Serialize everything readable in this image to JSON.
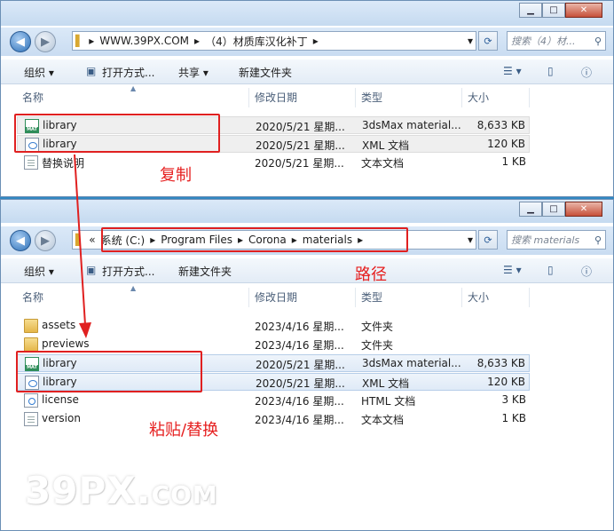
{
  "window1": {
    "controls": {
      "minimize": "▁",
      "maximize": "□",
      "close": "✕"
    },
    "breadcrumb": [
      "WWW.39PX.COM",
      "（4）材质库汉化补丁"
    ],
    "search_placeholder": "搜索（4）材...",
    "toolbar": {
      "organize": "组织",
      "open_with": "打开方式...",
      "share": "共享",
      "new_folder": "新建文件夹"
    },
    "columns": {
      "name": "名称",
      "date": "修改日期",
      "type": "类型",
      "size": "大小"
    },
    "files": [
      {
        "name": "library",
        "date": "2020/5/21 星期...",
        "type": "3dsMax material...",
        "size": "8,633 KB",
        "icon": "mat-file-icon"
      },
      {
        "name": "library",
        "date": "2020/5/21 星期...",
        "type": "XML 文档",
        "size": "120 KB",
        "icon": "xml-file-icon"
      },
      {
        "name": "替换说明",
        "date": "2020/5/21 星期...",
        "type": "文本文档",
        "size": "1 KB",
        "icon": "text-file-icon"
      }
    ]
  },
  "window2": {
    "controls": {
      "minimize": "▁",
      "maximize": "□",
      "close": "✕"
    },
    "breadcrumb": [
      "系统 (C:)",
      "Program Files",
      "Corona",
      "materials"
    ],
    "search_placeholder": "搜索 materials",
    "toolbar": {
      "organize": "组织",
      "open_with": "打开方式...",
      "new_folder": "新建文件夹"
    },
    "columns": {
      "name": "名称",
      "date": "修改日期",
      "type": "类型",
      "size": "大小"
    },
    "files": [
      {
        "name": "assets",
        "date": "2023/4/16 星期...",
        "type": "文件夹",
        "size": "",
        "icon": "folder-icon"
      },
      {
        "name": "previews",
        "date": "2023/4/16 星期...",
        "type": "文件夹",
        "size": "",
        "icon": "folder-icon"
      },
      {
        "name": "library",
        "date": "2020/5/21 星期...",
        "type": "3dsMax material...",
        "size": "8,633 KB",
        "icon": "mat-file-icon"
      },
      {
        "name": "library",
        "date": "2020/5/21 星期...",
        "type": "XML 文档",
        "size": "120 KB",
        "icon": "xml-file-icon"
      },
      {
        "name": "license",
        "date": "2023/4/16 星期...",
        "type": "HTML 文档",
        "size": "3 KB",
        "icon": "html-file-icon"
      },
      {
        "name": "version",
        "date": "2023/4/16 星期...",
        "type": "文本文档",
        "size": "1 KB",
        "icon": "text-file-icon"
      }
    ]
  },
  "annotations": {
    "copy": "复制",
    "path": "路径",
    "paste": "粘贴/替换"
  },
  "watermark": {
    "main": "39PX.",
    "suffix": "COM"
  },
  "colors": {
    "annotation_red": "#e02020",
    "selection_blue": "#dfeaf7"
  }
}
